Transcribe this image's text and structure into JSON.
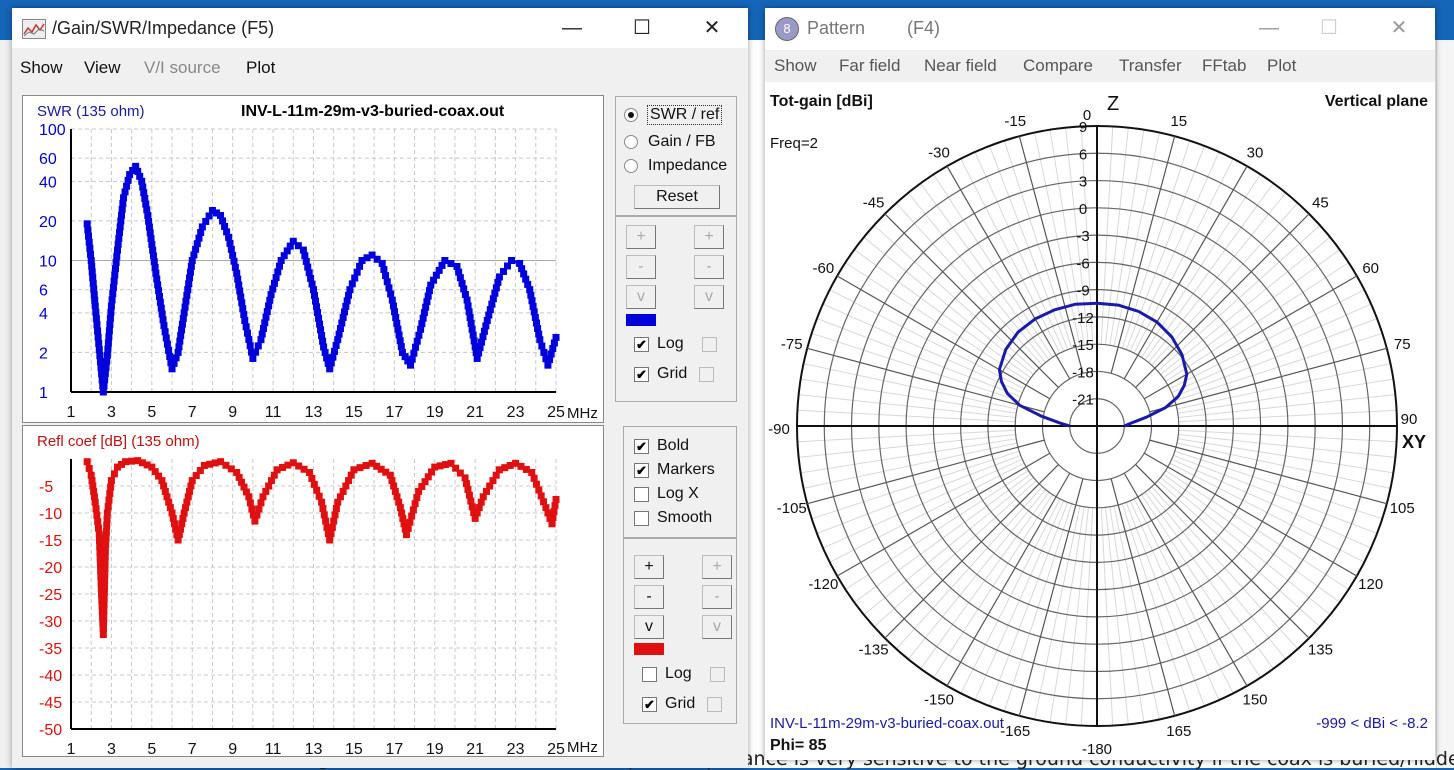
{
  "background": {
    "bottom_text": "One thing I have noticed is that the feed point impedance is very sensitive to the ground conductivity if the coax is buried/hidden."
  },
  "left_window": {
    "title": "/Gain/SWR/Impedance (F5)",
    "icon": "chart-app-icon",
    "controls": {
      "minimize": "—",
      "maximize": "☐",
      "close": "✕"
    },
    "menu": [
      {
        "label": "Show",
        "enabled": true
      },
      {
        "label": "View",
        "enabled": true
      },
      {
        "label": "V/I source",
        "enabled": false
      },
      {
        "label": "Plot",
        "enabled": true
      }
    ],
    "mode_panel": {
      "options": [
        {
          "label": "SWR / ref",
          "selected": true
        },
        {
          "label": "Gain / FB",
          "selected": false
        },
        {
          "label": "Impedance",
          "selected": false
        }
      ],
      "reset_label": "Reset"
    },
    "top_axis_panel": {
      "buttons": [
        "+",
        "-",
        "v"
      ],
      "swatch_color": "#0000dd",
      "log_label": "Log",
      "log_checked": true,
      "grid_label": "Grid",
      "grid_checked": true
    },
    "options_panel": {
      "items": [
        {
          "label": "Bold",
          "checked": true
        },
        {
          "label": "Markers",
          "checked": true
        },
        {
          "label": "Log X",
          "checked": false
        },
        {
          "label": "Smooth",
          "checked": false
        }
      ]
    },
    "bottom_axis_panel": {
      "buttons": [
        "+",
        "-",
        "v"
      ],
      "swatch_color": "#e01010",
      "log_label": "Log",
      "log_checked": false,
      "grid_label": "Grid",
      "grid_checked": true
    }
  },
  "right_window": {
    "title": "Pattern",
    "shortcut": "(F4)",
    "controls": {
      "minimize": "—",
      "maximize": "☐",
      "close": "✕"
    },
    "menu": [
      "Show",
      "Far field",
      "Near field",
      "Compare",
      "Transfer",
      "FFtab",
      "Plot"
    ],
    "top_left_label": "Tot-gain [dBi]",
    "top_right_label": "Vertical plane",
    "freq_label": "Freq=2",
    "z_label": "Z",
    "xy_label": "XY",
    "filename": "INV-L-11m-29m-v3-buried-coax.out",
    "range_label": "-999 < dBi < -8.2",
    "phi_label": "Phi= 85"
  },
  "chart_data": [
    {
      "type": "line",
      "title": "INV-L-11m-29m-v3-buried-coax.out",
      "ylabel": "SWR (135 ohm)",
      "xlabel": "MHz",
      "color": "#0000dd",
      "yscale": "log",
      "ylim": [
        1,
        100
      ],
      "xlim": [
        1,
        25
      ],
      "xticks": [
        1,
        3,
        5,
        7,
        9,
        11,
        13,
        15,
        17,
        19,
        21,
        23,
        25
      ],
      "yticks": [
        1,
        2,
        4,
        6,
        10,
        20,
        40,
        60,
        100
      ],
      "grid": true,
      "x": [
        1.8,
        2.0,
        2.2,
        2.4,
        2.6,
        2.8,
        3.0,
        3.3,
        3.6,
        3.9,
        4.2,
        4.5,
        4.8,
        5.2,
        5.6,
        6.0,
        6.3,
        6.6,
        7.0,
        7.5,
        8.0,
        8.4,
        8.8,
        9.2,
        9.6,
        10.0,
        10.4,
        10.9,
        11.4,
        12.0,
        12.5,
        13.0,
        13.5,
        13.8,
        14.2,
        14.8,
        15.4,
        15.9,
        16.4,
        16.9,
        17.4,
        17.8,
        18.3,
        18.8,
        19.5,
        20.1,
        20.6,
        21.1,
        21.6,
        22.2,
        22.8,
        23.2,
        23.7,
        24.2,
        24.6,
        25.0
      ],
      "values": [
        19,
        10,
        4.5,
        2.1,
        1.0,
        1.9,
        4.5,
        12,
        30,
        45,
        52,
        40,
        22,
        8,
        3.2,
        1.5,
        2.0,
        4,
        10,
        18,
        24,
        22,
        15,
        8,
        3.5,
        1.8,
        2.5,
        5.5,
        10,
        14,
        12,
        6,
        2.2,
        1.5,
        2.5,
        6,
        10,
        11,
        9.5,
        5,
        2,
        1.6,
        3,
        6.5,
        10,
        9,
        5,
        1.8,
        3.5,
        7.5,
        10,
        9.5,
        6,
        2.5,
        1.6,
        2.6
      ]
    },
    {
      "type": "line",
      "ylabel": "Refl coef [dB] (135 ohm)",
      "xlabel": "MHz",
      "color": "#e01010",
      "ylim": [
        -50,
        0
      ],
      "xlim": [
        1,
        25
      ],
      "xticks": [
        1,
        3,
        5,
        7,
        9,
        11,
        13,
        15,
        17,
        19,
        21,
        23,
        25
      ],
      "yticks": [
        -5,
        -10,
        -15,
        -20,
        -25,
        -30,
        -35,
        -40,
        -45,
        -50
      ],
      "grid": true,
      "x": [
        1.8,
        2.0,
        2.2,
        2.4,
        2.5,
        2.6,
        2.7,
        2.8,
        3.0,
        3.3,
        3.7,
        4.3,
        5.0,
        5.5,
        6.0,
        6.3,
        6.6,
        7.0,
        7.6,
        8.4,
        9.2,
        9.8,
        10.1,
        10.5,
        11.2,
        12.0,
        12.8,
        13.4,
        13.8,
        14.2,
        15.0,
        15.9,
        16.8,
        17.3,
        17.6,
        18.2,
        19.0,
        19.8,
        20.5,
        21.0,
        21.4,
        22.2,
        23.0,
        23.8,
        24.5,
        24.8,
        25.0
      ],
      "values": [
        -0.5,
        -3,
        -8,
        -14,
        -24,
        -32.5,
        -17,
        -10,
        -4,
        -1.5,
        -0.5,
        -0.3,
        -1.5,
        -4,
        -10,
        -15,
        -10,
        -4,
        -1.2,
        -0.5,
        -2.5,
        -7,
        -11.5,
        -7,
        -2,
        -0.7,
        -2.5,
        -8,
        -15,
        -8,
        -2,
        -0.8,
        -3,
        -9,
        -14,
        -6,
        -1.5,
        -0.8,
        -3.5,
        -11,
        -7,
        -2,
        -0.8,
        -2.5,
        -9,
        -12,
        -7.5
      ]
    },
    {
      "type": "polar",
      "title": "Tot-gain [dBi]",
      "subtitle": "Vertical plane",
      "color": "#1a1aa8",
      "radial_unit": "dBi",
      "radial_ticks": [
        9,
        6,
        3,
        0,
        -3,
        -6,
        -9,
        -12,
        -15,
        -18,
        -21
      ],
      "radial_range": [
        -24,
        9
      ],
      "angle_ticks": [
        0,
        15,
        30,
        45,
        60,
        75,
        90,
        105,
        120,
        135,
        150,
        165,
        -180,
        -165,
        -150,
        -135,
        -120,
        -105,
        -90,
        -75,
        -60,
        -45,
        -30,
        -15
      ],
      "pattern": {
        "angles_deg": [
          -90,
          -85,
          -80,
          -75,
          -70,
          -65,
          -60,
          -50,
          -40,
          -30,
          -20,
          -10,
          0,
          10,
          20,
          30,
          40,
          50,
          60,
          65,
          70,
          75,
          80,
          85,
          90
        ],
        "gain_dbi": [
          -21,
          -19.8,
          -17.8,
          -15.2,
          -13.5,
          -12.4,
          -11.6,
          -10.9,
          -10.5,
          -10.4,
          -10.4,
          -10.4,
          -10.5,
          -10.5,
          -10.6,
          -10.8,
          -11.2,
          -11.8,
          -12.6,
          -13.4,
          -14.5,
          -16.2,
          -18.5,
          -20.2,
          -21
        ]
      }
    }
  ]
}
